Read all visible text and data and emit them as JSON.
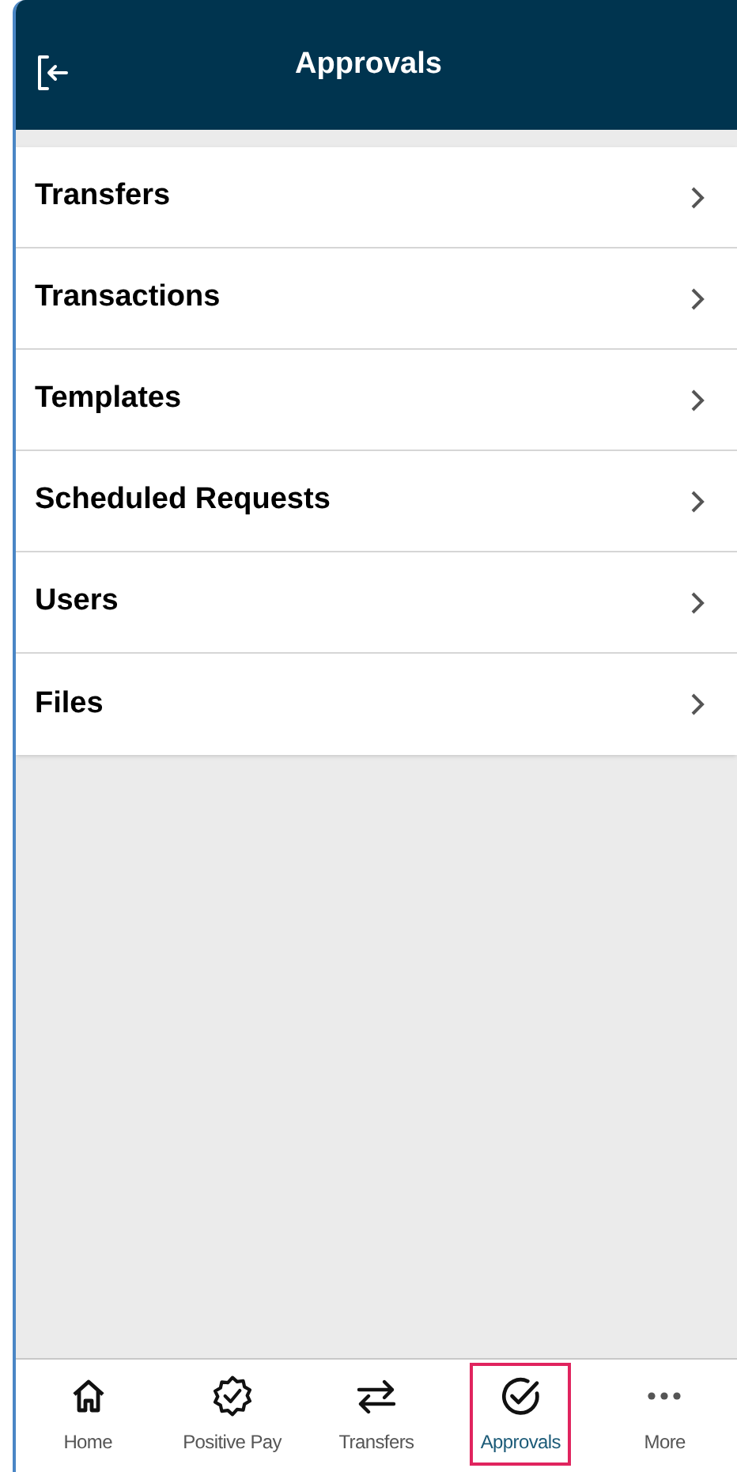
{
  "header": {
    "title": "Approvals"
  },
  "menu": [
    {
      "label": "Transfers"
    },
    {
      "label": "Transactions"
    },
    {
      "label": "Templates"
    },
    {
      "label": "Scheduled Requests"
    },
    {
      "label": "Users"
    },
    {
      "label": "Files"
    }
  ],
  "nav": [
    {
      "label": "Home",
      "kind": "home",
      "selected": false
    },
    {
      "label": "Positive Pay",
      "kind": "badge",
      "selected": false
    },
    {
      "label": "Transfers",
      "kind": "transfer",
      "selected": false
    },
    {
      "label": "Approvals",
      "kind": "check",
      "selected": true
    },
    {
      "label": "More",
      "kind": "more",
      "selected": false
    }
  ]
}
